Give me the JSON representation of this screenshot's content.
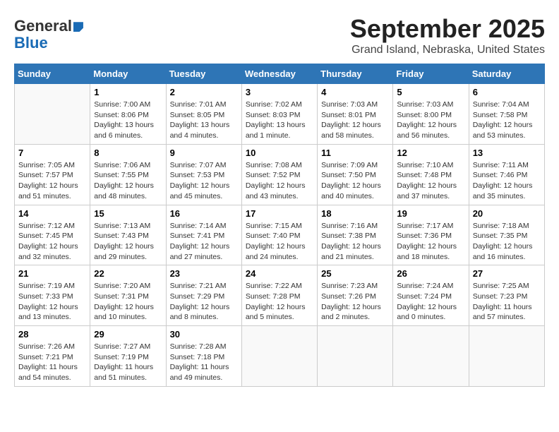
{
  "header": {
    "title": "September 2025",
    "subtitle": "Grand Island, Nebraska, United States",
    "logo_line1": "General",
    "logo_line2": "Blue"
  },
  "weekdays": [
    "Sunday",
    "Monday",
    "Tuesday",
    "Wednesday",
    "Thursday",
    "Friday",
    "Saturday"
  ],
  "weeks": [
    [
      {
        "day": "",
        "sunrise": "",
        "sunset": "",
        "daylight": ""
      },
      {
        "day": "1",
        "sunrise": "Sunrise: 7:00 AM",
        "sunset": "Sunset: 8:06 PM",
        "daylight": "Daylight: 13 hours and 6 minutes."
      },
      {
        "day": "2",
        "sunrise": "Sunrise: 7:01 AM",
        "sunset": "Sunset: 8:05 PM",
        "daylight": "Daylight: 13 hours and 4 minutes."
      },
      {
        "day": "3",
        "sunrise": "Sunrise: 7:02 AM",
        "sunset": "Sunset: 8:03 PM",
        "daylight": "Daylight: 13 hours and 1 minute."
      },
      {
        "day": "4",
        "sunrise": "Sunrise: 7:03 AM",
        "sunset": "Sunset: 8:01 PM",
        "daylight": "Daylight: 12 hours and 58 minutes."
      },
      {
        "day": "5",
        "sunrise": "Sunrise: 7:03 AM",
        "sunset": "Sunset: 8:00 PM",
        "daylight": "Daylight: 12 hours and 56 minutes."
      },
      {
        "day": "6",
        "sunrise": "Sunrise: 7:04 AM",
        "sunset": "Sunset: 7:58 PM",
        "daylight": "Daylight: 12 hours and 53 minutes."
      }
    ],
    [
      {
        "day": "7",
        "sunrise": "Sunrise: 7:05 AM",
        "sunset": "Sunset: 7:57 PM",
        "daylight": "Daylight: 12 hours and 51 minutes."
      },
      {
        "day": "8",
        "sunrise": "Sunrise: 7:06 AM",
        "sunset": "Sunset: 7:55 PM",
        "daylight": "Daylight: 12 hours and 48 minutes."
      },
      {
        "day": "9",
        "sunrise": "Sunrise: 7:07 AM",
        "sunset": "Sunset: 7:53 PM",
        "daylight": "Daylight: 12 hours and 45 minutes."
      },
      {
        "day": "10",
        "sunrise": "Sunrise: 7:08 AM",
        "sunset": "Sunset: 7:52 PM",
        "daylight": "Daylight: 12 hours and 43 minutes."
      },
      {
        "day": "11",
        "sunrise": "Sunrise: 7:09 AM",
        "sunset": "Sunset: 7:50 PM",
        "daylight": "Daylight: 12 hours and 40 minutes."
      },
      {
        "day": "12",
        "sunrise": "Sunrise: 7:10 AM",
        "sunset": "Sunset: 7:48 PM",
        "daylight": "Daylight: 12 hours and 37 minutes."
      },
      {
        "day": "13",
        "sunrise": "Sunrise: 7:11 AM",
        "sunset": "Sunset: 7:46 PM",
        "daylight": "Daylight: 12 hours and 35 minutes."
      }
    ],
    [
      {
        "day": "14",
        "sunrise": "Sunrise: 7:12 AM",
        "sunset": "Sunset: 7:45 PM",
        "daylight": "Daylight: 12 hours and 32 minutes."
      },
      {
        "day": "15",
        "sunrise": "Sunrise: 7:13 AM",
        "sunset": "Sunset: 7:43 PM",
        "daylight": "Daylight: 12 hours and 29 minutes."
      },
      {
        "day": "16",
        "sunrise": "Sunrise: 7:14 AM",
        "sunset": "Sunset: 7:41 PM",
        "daylight": "Daylight: 12 hours and 27 minutes."
      },
      {
        "day": "17",
        "sunrise": "Sunrise: 7:15 AM",
        "sunset": "Sunset: 7:40 PM",
        "daylight": "Daylight: 12 hours and 24 minutes."
      },
      {
        "day": "18",
        "sunrise": "Sunrise: 7:16 AM",
        "sunset": "Sunset: 7:38 PM",
        "daylight": "Daylight: 12 hours and 21 minutes."
      },
      {
        "day": "19",
        "sunrise": "Sunrise: 7:17 AM",
        "sunset": "Sunset: 7:36 PM",
        "daylight": "Daylight: 12 hours and 18 minutes."
      },
      {
        "day": "20",
        "sunrise": "Sunrise: 7:18 AM",
        "sunset": "Sunset: 7:35 PM",
        "daylight": "Daylight: 12 hours and 16 minutes."
      }
    ],
    [
      {
        "day": "21",
        "sunrise": "Sunrise: 7:19 AM",
        "sunset": "Sunset: 7:33 PM",
        "daylight": "Daylight: 12 hours and 13 minutes."
      },
      {
        "day": "22",
        "sunrise": "Sunrise: 7:20 AM",
        "sunset": "Sunset: 7:31 PM",
        "daylight": "Daylight: 12 hours and 10 minutes."
      },
      {
        "day": "23",
        "sunrise": "Sunrise: 7:21 AM",
        "sunset": "Sunset: 7:29 PM",
        "daylight": "Daylight: 12 hours and 8 minutes."
      },
      {
        "day": "24",
        "sunrise": "Sunrise: 7:22 AM",
        "sunset": "Sunset: 7:28 PM",
        "daylight": "Daylight: 12 hours and 5 minutes."
      },
      {
        "day": "25",
        "sunrise": "Sunrise: 7:23 AM",
        "sunset": "Sunset: 7:26 PM",
        "daylight": "Daylight: 12 hours and 2 minutes."
      },
      {
        "day": "26",
        "sunrise": "Sunrise: 7:24 AM",
        "sunset": "Sunset: 7:24 PM",
        "daylight": "Daylight: 12 hours and 0 minutes."
      },
      {
        "day": "27",
        "sunrise": "Sunrise: 7:25 AM",
        "sunset": "Sunset: 7:23 PM",
        "daylight": "Daylight: 11 hours and 57 minutes."
      }
    ],
    [
      {
        "day": "28",
        "sunrise": "Sunrise: 7:26 AM",
        "sunset": "Sunset: 7:21 PM",
        "daylight": "Daylight: 11 hours and 54 minutes."
      },
      {
        "day": "29",
        "sunrise": "Sunrise: 7:27 AM",
        "sunset": "Sunset: 7:19 PM",
        "daylight": "Daylight: 11 hours and 51 minutes."
      },
      {
        "day": "30",
        "sunrise": "Sunrise: 7:28 AM",
        "sunset": "Sunset: 7:18 PM",
        "daylight": "Daylight: 11 hours and 49 minutes."
      },
      {
        "day": "",
        "sunrise": "",
        "sunset": "",
        "daylight": ""
      },
      {
        "day": "",
        "sunrise": "",
        "sunset": "",
        "daylight": ""
      },
      {
        "day": "",
        "sunrise": "",
        "sunset": "",
        "daylight": ""
      },
      {
        "day": "",
        "sunrise": "",
        "sunset": "",
        "daylight": ""
      }
    ]
  ]
}
